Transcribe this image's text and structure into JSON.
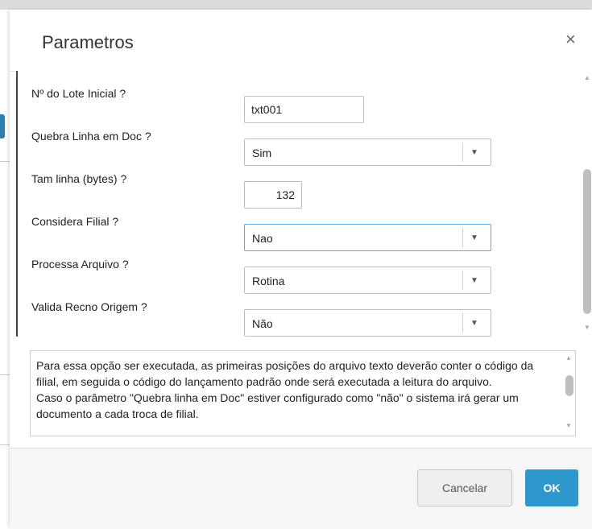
{
  "dialog": {
    "title": "Parametros",
    "close_glyph": "×"
  },
  "params": [
    {
      "label": "Nº do Lote Inicial ?",
      "control": "text",
      "value": "txt001"
    },
    {
      "label": "Quebra Linha em Doc ?",
      "control": "combo",
      "value": "Sim"
    },
    {
      "label": "Tam linha (bytes) ?",
      "control": "number",
      "value": "132"
    },
    {
      "label": "Considera Filial ?",
      "control": "combo",
      "value": "Nao",
      "focused": true
    },
    {
      "label": "Processa Arquivo ?",
      "control": "combo",
      "value": "Rotina"
    },
    {
      "label": "Valida Recno Origem ?",
      "control": "combo",
      "value": "Não"
    }
  ],
  "help": {
    "text": "Para essa opção ser executada, as primeiras posições do arquivo texto deverão conter o código da filial, em seguida o código do lançamento padrão onde será executada a leitura do arquivo.\nCaso o parâmetro \"Quebra linha em Doc\" estiver configurado como \"não\" o sistema irá gerar um documento a cada troca de filial."
  },
  "footer": {
    "cancel_label": "Cancelar",
    "ok_label": "OK"
  },
  "icons": {
    "dropdown": "dropdown-arrow-icon",
    "scroll_up": "scroll-up-icon",
    "scroll_down": "scroll-down-icon",
    "close": "close-icon"
  },
  "colors": {
    "primary_button": "#2e97cc",
    "focus_border": "#6aa5d6"
  }
}
